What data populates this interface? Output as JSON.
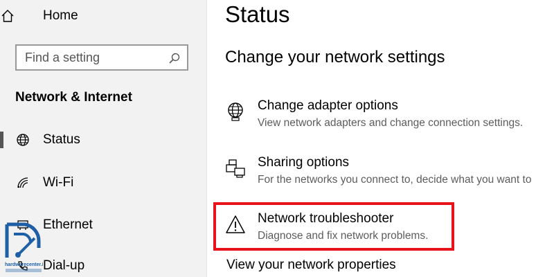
{
  "sidebar": {
    "home_label": "Home",
    "search_placeholder": "Find a setting",
    "section_heading": "Network & Internet",
    "items": [
      {
        "label": "Status",
        "icon": "globe-icon",
        "selected": true
      },
      {
        "label": "Wi-Fi",
        "icon": "wifi-icon",
        "selected": false
      },
      {
        "label": "Ethernet",
        "icon": "ethernet-icon",
        "selected": false
      },
      {
        "label": "Dial-up",
        "icon": "dialup-icon",
        "selected": false
      }
    ],
    "watermark": "hardwarecenter.ir"
  },
  "main": {
    "title": "Status",
    "subtitle": "Change your network settings",
    "options": [
      {
        "title": "Change adapter options",
        "description": "View network adapters and change connection settings.",
        "icon": "adapter-globe-icon"
      },
      {
        "title": "Sharing options",
        "description": "For the networks you connect to, decide what you want to",
        "icon": "sharing-icon"
      },
      {
        "title": "Network troubleshooter",
        "description": "Diagnose and fix network problems.",
        "icon": "warning-icon",
        "highlighted": true
      }
    ],
    "view_properties_link": "View your network properties"
  },
  "colors": {
    "sidebar_bg": "#f2f2f2",
    "highlight_border": "#e8141b",
    "description_text": "#5c5c5c",
    "logo_blue": "#1e5fa6"
  }
}
